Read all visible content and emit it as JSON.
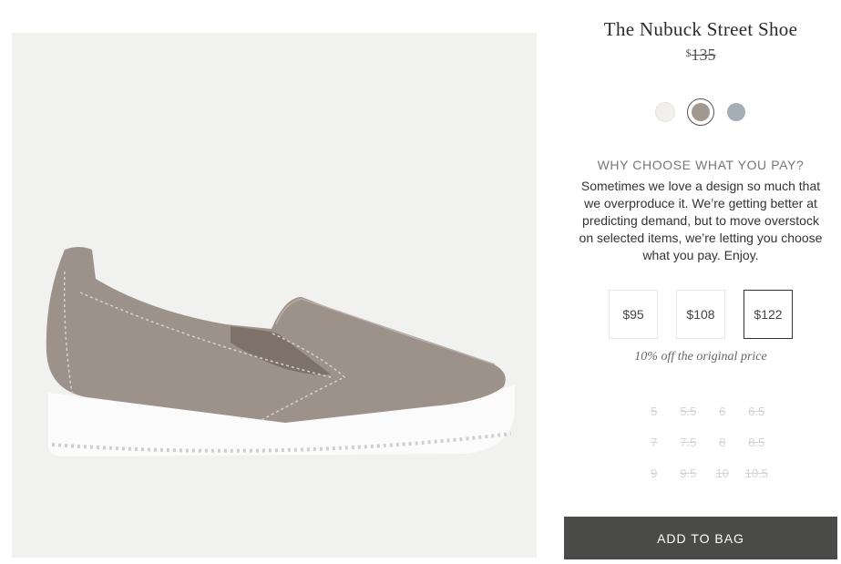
{
  "product": {
    "title": "The Nubuck Street Shoe",
    "currency": "$",
    "original_price": "135",
    "image_icon": "shoe-image"
  },
  "swatches": [
    {
      "name": "white",
      "color": "#f1f0ec",
      "selected": false
    },
    {
      "name": "taupe",
      "color": "#a39890",
      "selected": true
    },
    {
      "name": "grey-blue",
      "color": "#a3aeb6",
      "selected": false
    }
  ],
  "choose": {
    "heading": "WHY CHOOSE WHAT YOU PAY?",
    "description": "Sometimes we love a design so much that we overproduce it. We’re getting better at predicting demand, but to move overstock on selected items, we’re letting you choose what you pay. Enjoy."
  },
  "price_options": [
    {
      "label": "$95",
      "selected": false
    },
    {
      "label": "$108",
      "selected": false
    },
    {
      "label": "$122",
      "selected": true
    }
  ],
  "discount_note": "10% off the original price",
  "sizes": [
    [
      "5",
      "5.5",
      "6",
      "6.5"
    ],
    [
      "7",
      "7.5",
      "8",
      "8.5"
    ],
    [
      "9",
      "9.5",
      "10",
      "10.5"
    ]
  ],
  "add_to_bag": "ADD TO BAG",
  "colors": {
    "button_bg": "#4a4a48",
    "image_bg": "#f1f1f0",
    "shoe": "#9c928a",
    "sole": "#ffffff"
  }
}
